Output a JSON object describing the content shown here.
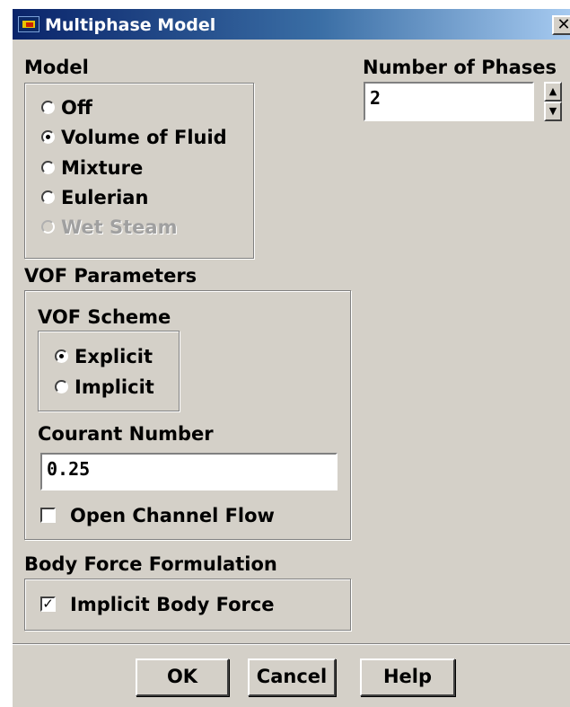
{
  "window": {
    "title": "Multiphase Model",
    "close_glyph": "✕"
  },
  "model": {
    "label": "Model",
    "options": [
      {
        "label": "Off",
        "selected": false,
        "enabled": true
      },
      {
        "label": "Volume of Fluid",
        "selected": true,
        "enabled": true
      },
      {
        "label": "Mixture",
        "selected": false,
        "enabled": true
      },
      {
        "label": "Eulerian",
        "selected": false,
        "enabled": true
      },
      {
        "label": "Wet Steam",
        "selected": false,
        "enabled": false
      }
    ]
  },
  "phases": {
    "label": "Number of Phases",
    "value": "2"
  },
  "vof": {
    "label": "VOF Parameters",
    "scheme_label": "VOF Scheme",
    "schemes": [
      {
        "label": "Explicit",
        "selected": true
      },
      {
        "label": "Implicit",
        "selected": false
      }
    ],
    "courant_label": "Courant Number",
    "courant_value": "0.25",
    "open_channel_label": "Open Channel Flow",
    "open_channel_checked": false
  },
  "body_force": {
    "label": "Body Force Formulation",
    "implicit_label": "Implicit Body Force",
    "implicit_checked": true
  },
  "buttons": {
    "ok": "OK",
    "cancel": "Cancel",
    "help": "Help"
  }
}
